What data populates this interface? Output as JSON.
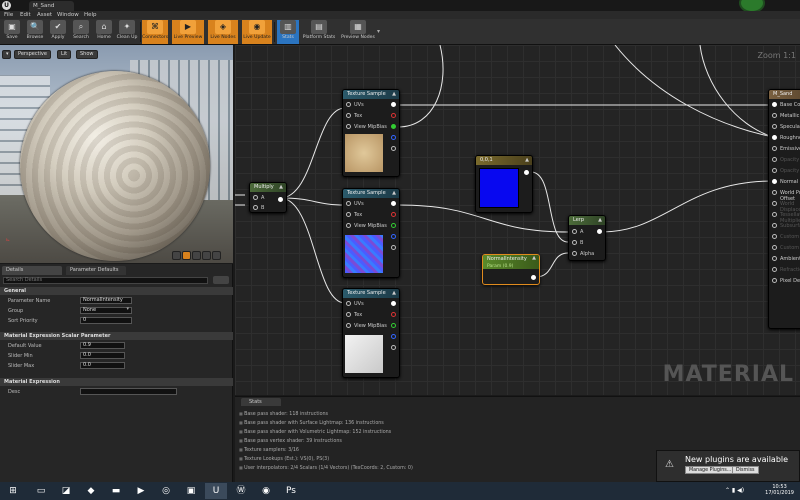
{
  "titlebar": {
    "tab_label": "M_Sand"
  },
  "menu": [
    "File",
    "Edit",
    "Asset",
    "Window",
    "Help"
  ],
  "toolbar": {
    "buttons": [
      "Save",
      "Browse",
      "Apply",
      "Search",
      "Home",
      "Clean Up",
      "Connectors",
      "Live Preview",
      "Live Nodes",
      "Live Update",
      "Stats",
      "Platform Stats",
      "Preview Nodes"
    ]
  },
  "viewport": {
    "perspective": "Perspective",
    "lit": "Lit",
    "show": "Show"
  },
  "details": {
    "tab_details": "Details",
    "tab_params": "Parameter Defaults",
    "search_placeholder": "Search Details",
    "general_header": "General",
    "parameter_name_label": "Parameter Name",
    "parameter_name_value": "NormalIntensity",
    "group_label": "Group",
    "group_value": "None",
    "sort_priority_label": "Sort Priority",
    "sort_priority_value": "0",
    "scalar_header": "Material Expression Scalar Parameter",
    "default_value_label": "Default Value",
    "default_value": "0.9",
    "slider_min_label": "Slider Min",
    "slider_min_value": "0.0",
    "slider_max_label": "Slider Max",
    "slider_max_value": "0.0",
    "expression_header": "Material Expression",
    "desc_label": "Desc"
  },
  "graph": {
    "zoom": "Zoom 1:1",
    "watermark": "MATERIAL",
    "multiply": {
      "title": "Multiply",
      "a": "A",
      "b": "B"
    },
    "tex1": {
      "title": "Texture Sample",
      "uvs": "UVs",
      "tex": "Tex",
      "mip": "View MipBias"
    },
    "tex2": {
      "title": "Texture Sample",
      "uvs": "UVs",
      "tex": "Tex",
      "mip": "View MipBias"
    },
    "tex3": {
      "title": "Texture Sample",
      "uvs": "UVs",
      "tex": "Tex",
      "mip": "View MipBias"
    },
    "const": {
      "title": "0,0,1"
    },
    "lerp": {
      "title": "Lerp",
      "a": "A",
      "b": "B",
      "alpha": "Alpha"
    },
    "param": {
      "title": "NormalIntensity",
      "sub": "Param (0.9)"
    },
    "material": {
      "title": "M_Sand",
      "pins": [
        "Base Color",
        "Metallic",
        "Specular",
        "Roughness",
        "Emissive Color",
        "Opacity",
        "Opacity Mask",
        "Normal",
        "World Position Offset",
        "World Displacement",
        "Tessellation Multiplier",
        "Subsurface Color",
        "Custom Data 0",
        "Custom Data 1",
        "Ambient Occlusion",
        "Refraction",
        "Pixel Depth Offset"
      ]
    }
  },
  "stats": {
    "tab": "Stats",
    "lines": [
      "Base pass shader: 118 instructions",
      "Base pass shader with Surface Lightmap: 136 instructions",
      "Base pass shader with Volumetric Lightmap: 152 instructions",
      "Base pass vertex shader: 39 instructions",
      "Texture samplers: 3/16",
      "Texture Lookups (Est.): VS(0), PS(3)",
      "User interpolators: 2/4 Scalars (1/4 Vectors) (TexCoords: 2, Custom: 0)"
    ]
  },
  "notification": {
    "title": "New plugins are available",
    "manage": "Manage Plugins...",
    "dismiss": "Dismiss"
  },
  "taskbar": {
    "time": "10:53",
    "date": "17/01/2019"
  }
}
